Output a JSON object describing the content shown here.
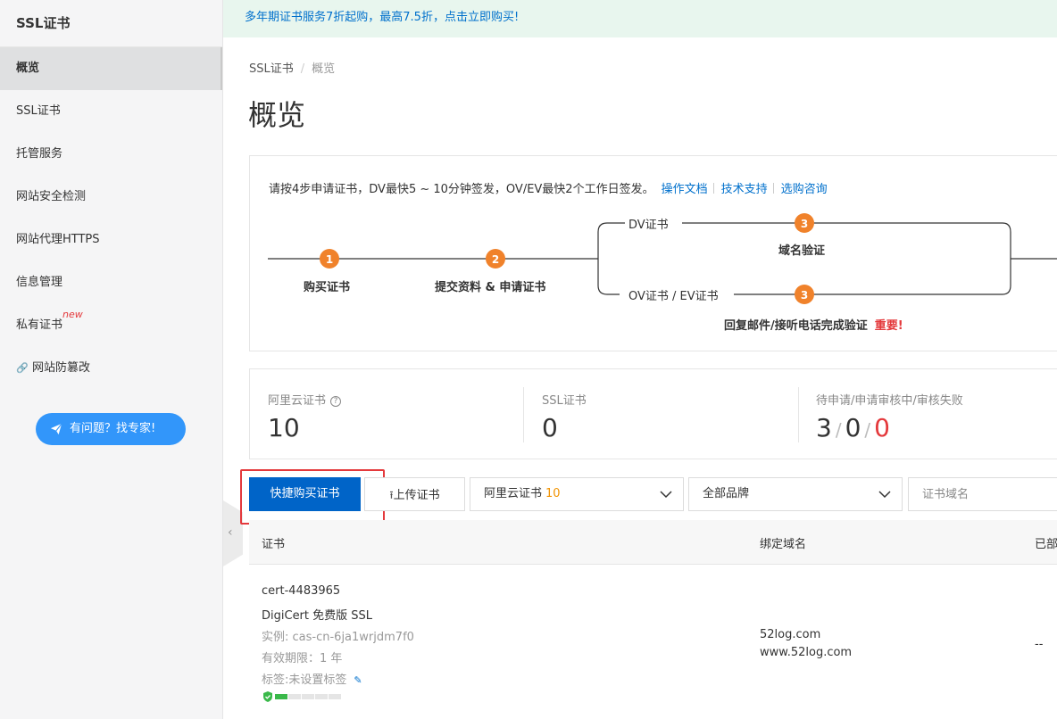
{
  "sidebar": {
    "title": "SSL证书",
    "items": [
      {
        "label": "概览"
      },
      {
        "label": "SSL证书"
      },
      {
        "label": "托管服务"
      },
      {
        "label": "网站安全检测"
      },
      {
        "label": "网站代理HTTPS"
      },
      {
        "label": "信息管理"
      },
      {
        "label": "私有证书",
        "badge": "new"
      },
      {
        "label": "网站防篡改"
      }
    ],
    "help_button": "有问题？找专家!"
  },
  "promo": "多年期证书服务7折起购，最高7.5折，点击立即购买!",
  "breadcrumb": [
    "SSL证书",
    "/",
    "概览"
  ],
  "page_title": "概览",
  "steps": {
    "intro": "请按4步申请证书，DV最快5 ~ 10分钟签发，OV/EV最快2个工作日签发。",
    "links": [
      "操作文档",
      "技术支持",
      "选购咨询"
    ],
    "step1_num": "1",
    "step1_label": "购买证书",
    "step2_num": "2",
    "step2_label": "提交资料 & 申请证书",
    "dv_branch": "DV证书",
    "dv_num": "3",
    "dv_label": "域名验证",
    "ov_branch": "OV证书 / EV证书",
    "ov_num": "3",
    "ov_label": "回复邮件/接听电话完成验证",
    "important": "重要!"
  },
  "stats": {
    "aliyun_label": "阿里云证书",
    "aliyun_value": "10",
    "ssl_label": "SSL证书",
    "ssl_value": "0",
    "pending_label": "待申请/申请审核中/审核失败",
    "pending_a": "3",
    "pending_b": "0",
    "pending_c": "0",
    "slash": "/"
  },
  "toolbar": {
    "buy_label": "快捷购买证书",
    "upload_label": "上传证书",
    "type_select": "阿里云证书",
    "type_count": "10",
    "brand_select": "全部品牌",
    "domain_placeholder": "证书域名"
  },
  "table": {
    "headers": [
      "证书",
      "绑定域名",
      "已部"
    ],
    "rows": [
      {
        "cert_id": "cert-4483965",
        "cert_name": "DigiCert 免费版 SSL",
        "instance": "实例: cas-cn-6ja1wrjdm7f0",
        "validity": "有效期限：1 年",
        "tag": "标签:未设置标签",
        "domains": [
          "52log.com",
          "www.52log.com"
        ],
        "deployed": "--",
        "strength": 0.2
      }
    ]
  },
  "colors": {
    "primary": "#0064c8",
    "link": "#0070cc",
    "step_orange": "#f0822b",
    "danger": "#e4393c",
    "promo_bg": "#e8f6ee"
  }
}
